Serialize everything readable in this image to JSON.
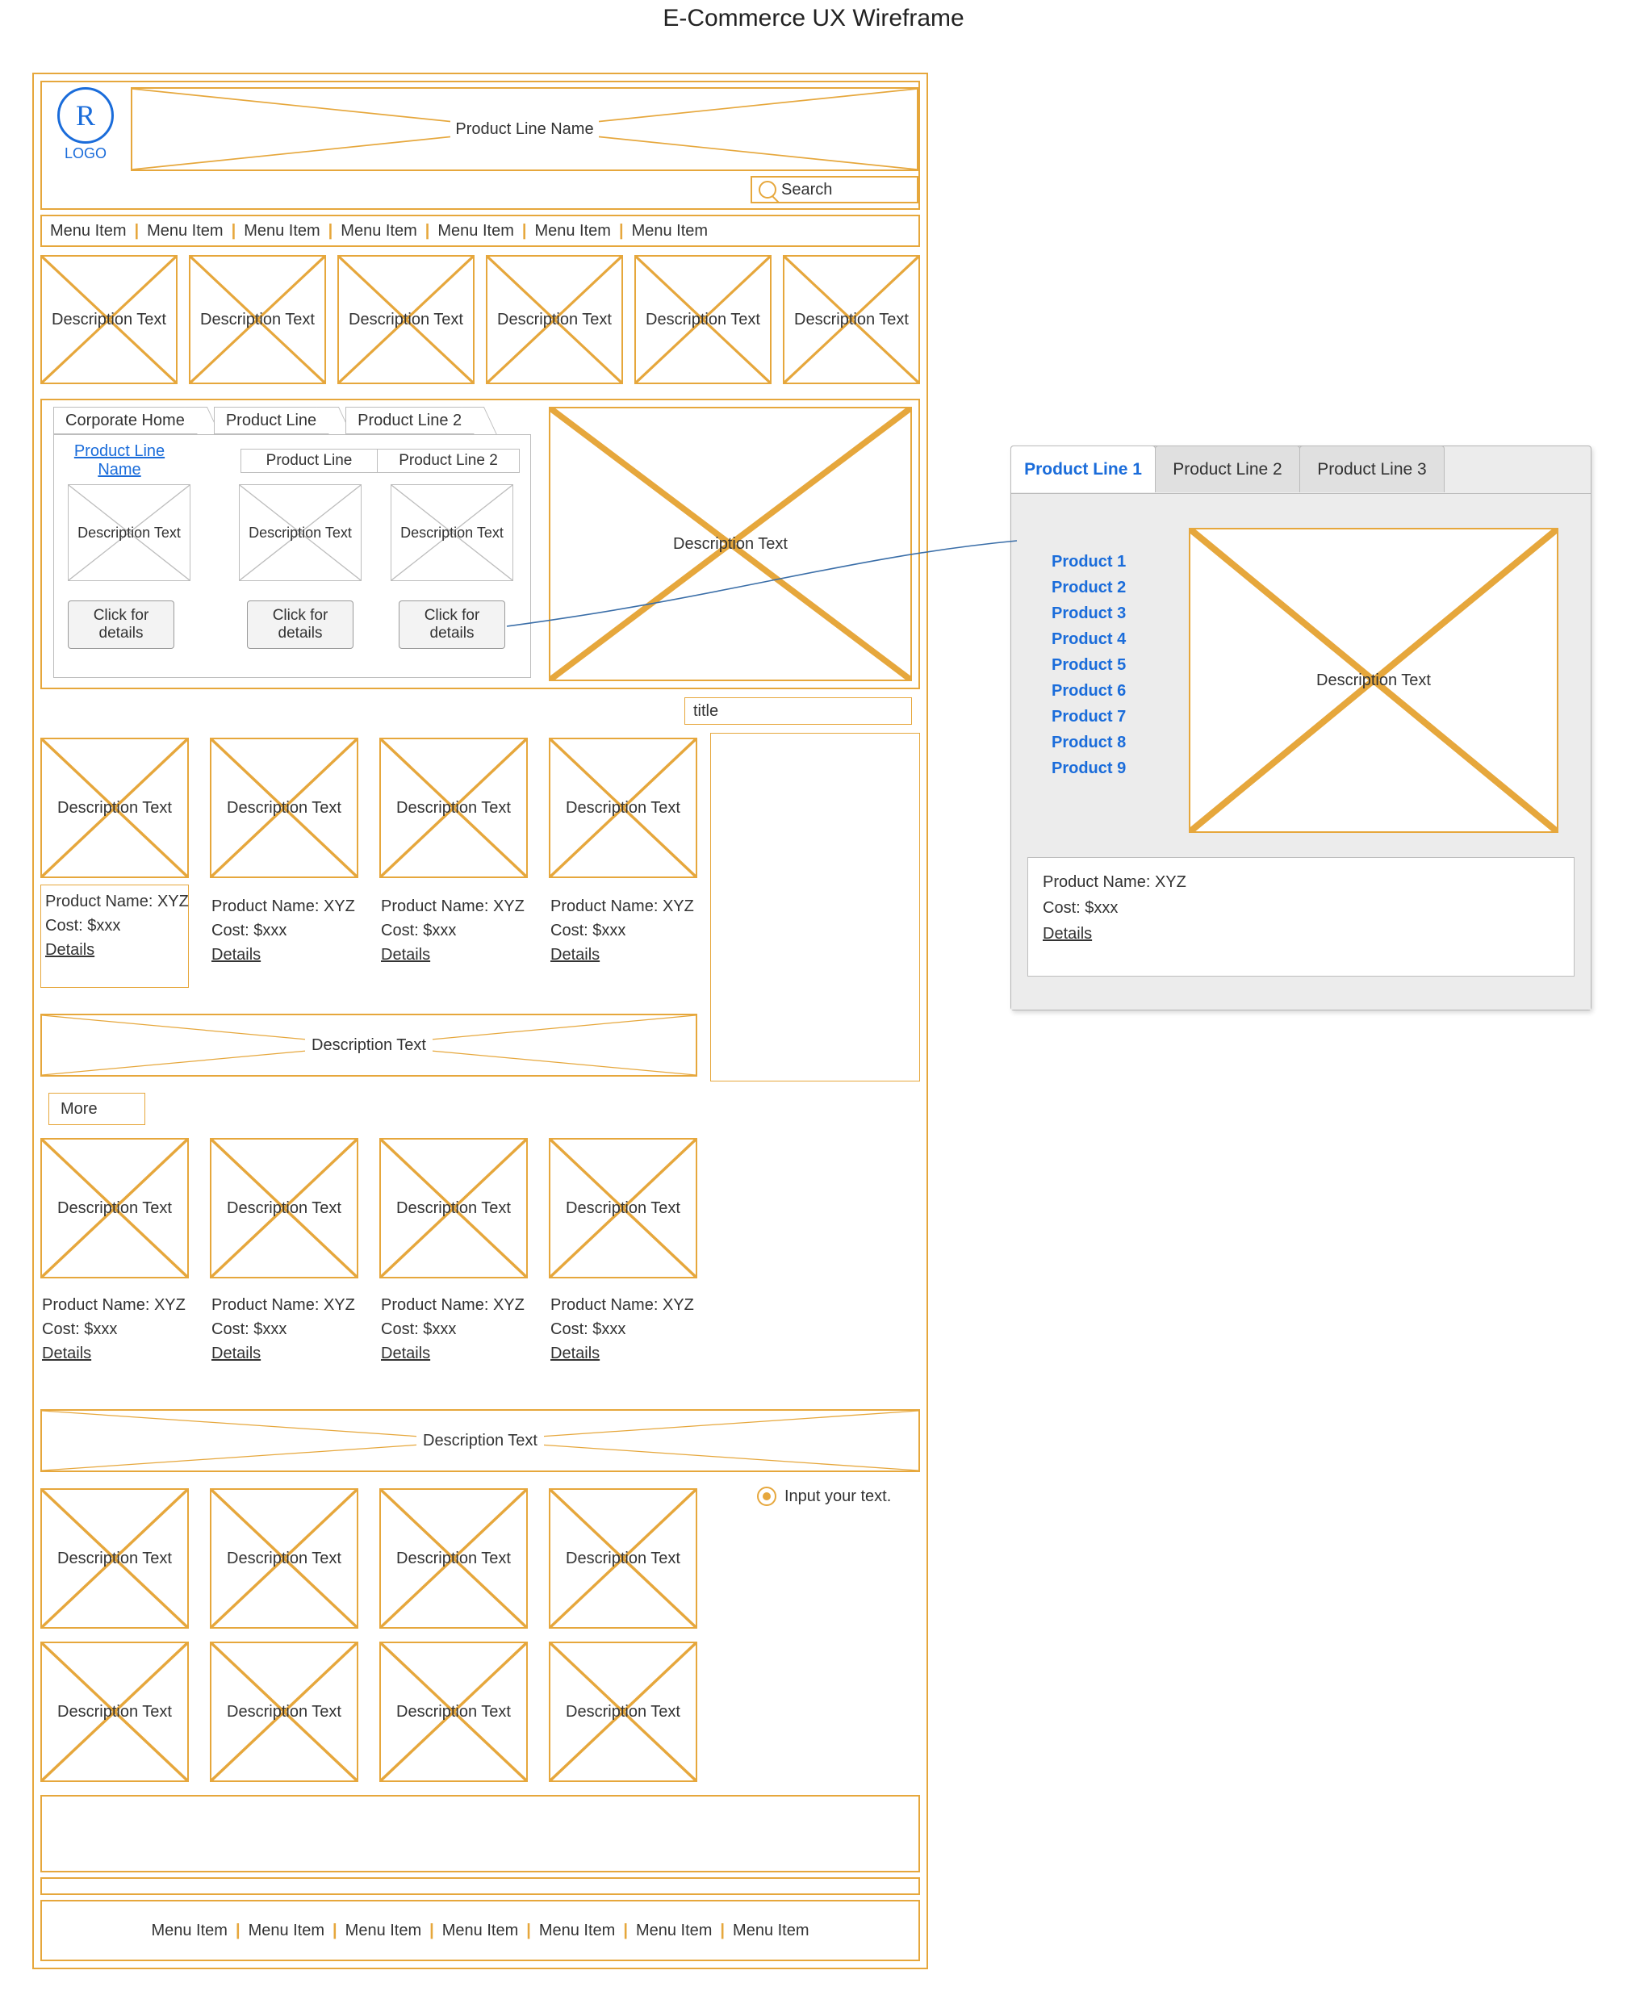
{
  "page_title": "E-Commerce UX Wireframe",
  "logo_text": "LOGO",
  "logo_mark": "R",
  "hero_banner": "Product Line Name",
  "search_placeholder": "Search",
  "top_menu": [
    "Menu Item",
    "Menu Item",
    "Menu Item",
    "Menu Item",
    "Menu Item",
    "Menu Item",
    "Menu Item"
  ],
  "tile_label": "Description Text",
  "breadcrumbs": [
    "Corporate Home",
    "Product Line",
    "Product Line 2"
  ],
  "panel1": {
    "sidebar_link": "Product Line Name",
    "subtabs": [
      "Product Line",
      "Product Line 2"
    ],
    "inner_card_label": "Description Text",
    "cta": "Click for details",
    "right_image_label": "Description Text"
  },
  "title_field": "title",
  "product_card": {
    "name_line": "Product Name: XYZ",
    "cost_line": "Cost: $xxx",
    "details": "Details"
  },
  "banner2": "Description Text",
  "more_btn": "More",
  "banner3": "Description Text",
  "radio_label": "Input your text.",
  "footer_menu": [
    "Menu Item",
    "Menu Item",
    "Menu Item",
    "Menu Item",
    "Menu Item",
    "Menu Item",
    "Menu Item"
  ],
  "right_panel": {
    "tabs": [
      "Product Line 1",
      "Product Line 2",
      "Product Line  3"
    ],
    "products": [
      "Product 1",
      "Product 2",
      "Product 3",
      "Product 4",
      "Product 5",
      "Product 6",
      "Product 7",
      "Product 8",
      "Product 9"
    ],
    "image_label": "Description Text",
    "info_name": "Product Name: XYZ",
    "info_cost": "Cost: $xxx",
    "info_details": "Details"
  }
}
